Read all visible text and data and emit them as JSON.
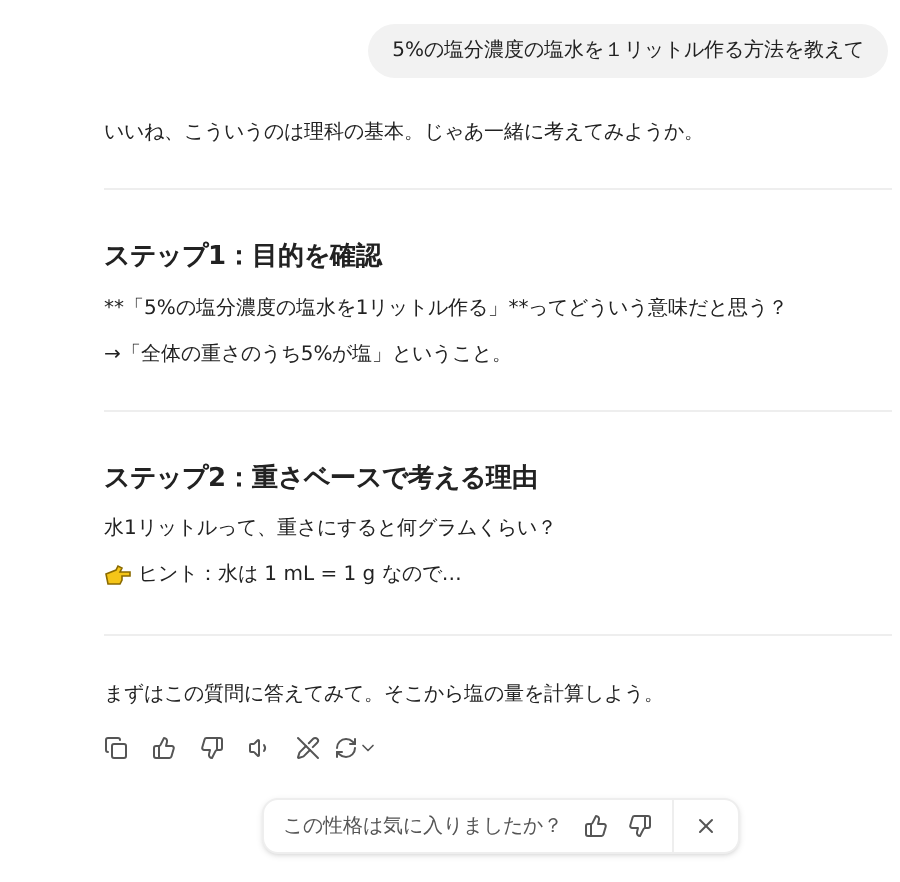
{
  "user_message": "5%の塩分濃度の塩水を１リットル作る方法を教えて",
  "intro": "いいね、こういうのは理科の基本。じゃあ一緒に考えてみようか。",
  "sections": [
    {
      "heading": "ステップ1：目的を確認",
      "lines": [
        {
          "kind": "text",
          "text": "**「5%の塩分濃度の塩水を1リットル作る」**ってどういう意味だと思う？"
        },
        {
          "kind": "text",
          "text": "→「全体の重さのうち5%が塩」ということ。"
        }
      ]
    },
    {
      "heading": "ステップ2：重さベースで考える理由",
      "lines": [
        {
          "kind": "text",
          "text": "水1リットルって、重さにすると何グラムくらい？"
        },
        {
          "kind": "hint",
          "text": "ヒント：水は 1 mL = 1 g なので…"
        }
      ]
    }
  ],
  "closing": "まずはこの質問に答えてみて。そこから塩の量を計算しよう。",
  "feedback": {
    "question": "この性格は気に入りましたか？"
  }
}
